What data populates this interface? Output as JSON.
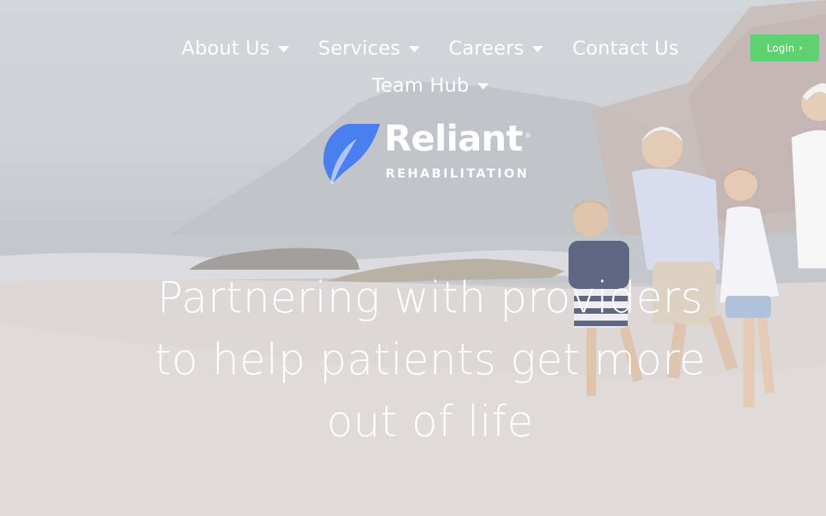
{
  "nav": {
    "items": [
      {
        "label": "About Us",
        "has_dropdown": true
      },
      {
        "label": "Services",
        "has_dropdown": true
      },
      {
        "label": "Careers",
        "has_dropdown": true
      },
      {
        "label": "Contact Us",
        "has_dropdown": false
      },
      {
        "label": "Team Hub",
        "has_dropdown": true
      }
    ]
  },
  "login": {
    "label": "Login",
    "icon": "chevron-right-icon"
  },
  "logo": {
    "name": "Reliant",
    "registered": "®",
    "subtitle": "REHABILITATION",
    "leaf_color": "#4a7ff0"
  },
  "hero": {
    "headline": "Partnering with providers to help patients get more out of life",
    "image_subject": "beach-family-running"
  },
  "colors": {
    "login_bg": "#5fd16f",
    "text": "#ffffff"
  }
}
